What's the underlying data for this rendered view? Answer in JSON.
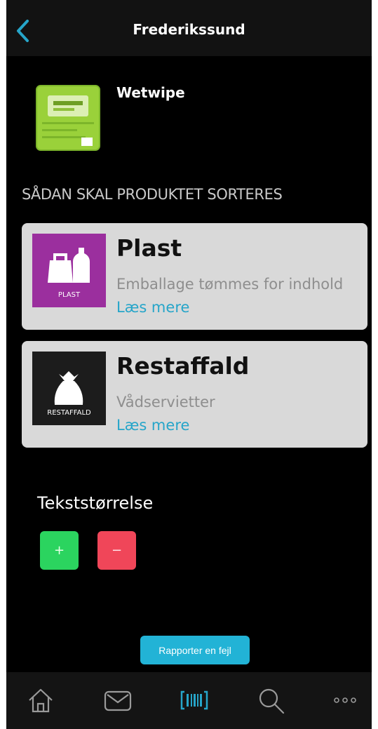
{
  "header": {
    "title": "Frederikssund"
  },
  "product": {
    "name": "Wetwipe"
  },
  "section_title": "SÅDAN SKAL PRODUKTET SORTERES",
  "cards": [
    {
      "name": "Plast",
      "description": "Emballage tømmes for indhold",
      "link": "Læs mere",
      "badge_label": "PLAST",
      "badge_color": "#9b2f9e"
    },
    {
      "name": "Restaffald",
      "description": "Vådservietter",
      "link": "Læs mere",
      "badge_label": "RESTAFFALD",
      "badge_color": "#1c1c1c"
    }
  ],
  "text_size": {
    "label": "Tekststørrelse",
    "plus": "+",
    "minus": "−"
  },
  "report_button": "Rapporter en fejl",
  "tabs": [
    {
      "icon": "home-icon"
    },
    {
      "icon": "mail-icon"
    },
    {
      "icon": "barcode-scan-icon",
      "active": true
    },
    {
      "icon": "search-icon"
    },
    {
      "icon": "more-icon"
    }
  ],
  "colors": {
    "accent": "#26a5c9",
    "plus": "#2bd45f",
    "minus": "#f04659"
  }
}
